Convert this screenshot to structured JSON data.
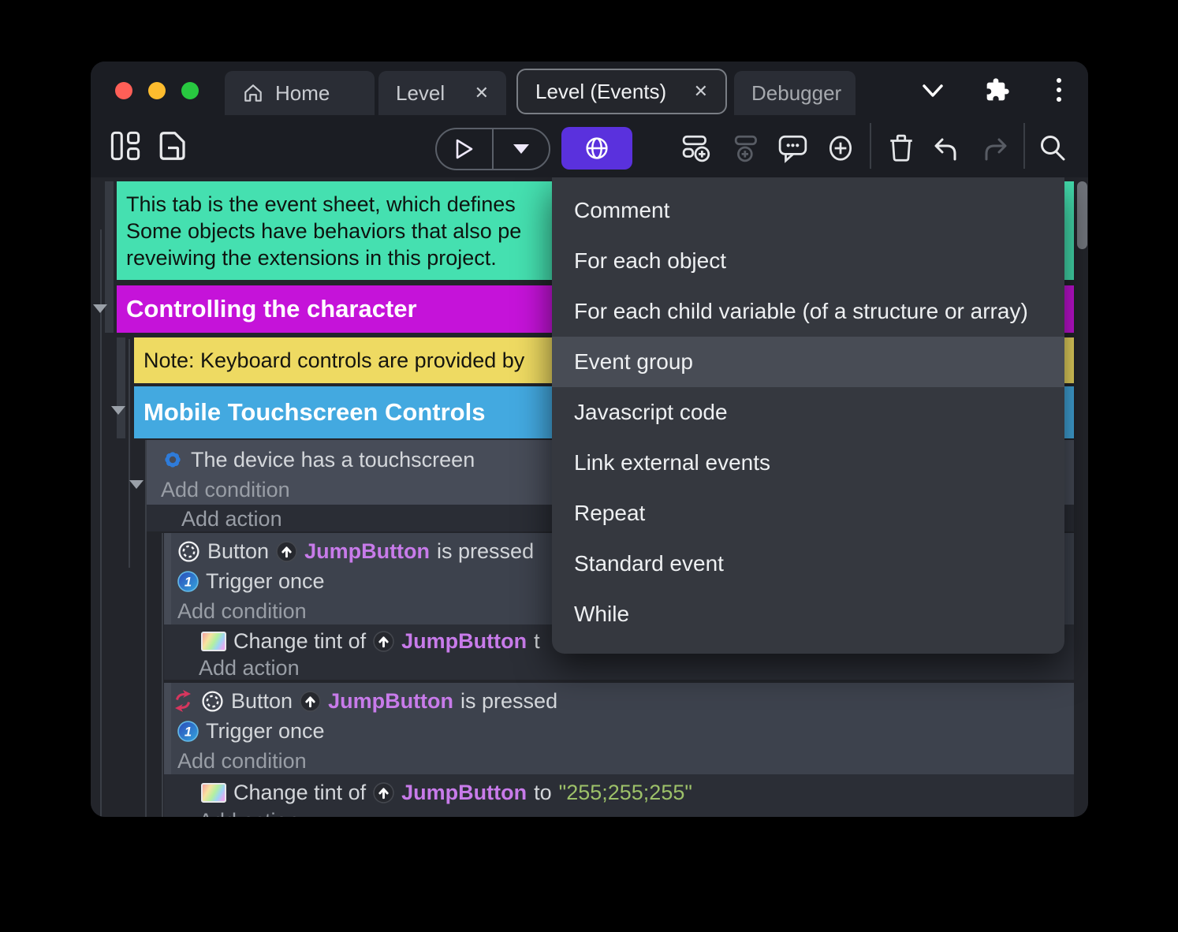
{
  "tabbar": {
    "tabs": [
      {
        "label": "Home"
      },
      {
        "label": "Level"
      },
      {
        "label": "Level (Events)"
      },
      {
        "label": "Debugger"
      }
    ],
    "close_glyph": "✕"
  },
  "event_sheet": {
    "comment_line1": "This tab is the event sheet, which defines",
    "comment_line2": "Some objects have behaviors that also pe",
    "comment_line3": "reveiwing the extensions in this project.",
    "group_controlling": "Controlling the character",
    "note": "Note: Keyboard controls are provided by",
    "group_mobile": "Mobile Touchscreen Controls",
    "device_condition": "The device has a touchscreen",
    "add_condition": "Add condition",
    "add_action": "Add action",
    "button_obj": "Button",
    "jump_button": "JumpButton",
    "is_pressed": "is pressed",
    "trigger_once": "Trigger once",
    "change_tint_prefix": "Change tint of",
    "to_clipped": "t",
    "to_word": "to",
    "tint_value": "\"255;255;255\""
  },
  "context_menu": {
    "items": [
      "Comment",
      "For each object",
      "For each child variable (of a structure or array)",
      "Event group",
      "Javascript code",
      "Link external events",
      "Repeat",
      "Standard event",
      "While"
    ],
    "highlighted": "Event group",
    "highlighted_index": 3
  },
  "colors": {
    "accent_purple": "#5a31dd",
    "comment_green": "#45e0b0",
    "group_magenta": "#c513d9",
    "note_yellow": "#eeda62",
    "group_blue": "#43a9e0",
    "object_purple": "#c87bea",
    "string_green": "#9dc169",
    "menu_highlight": "#484c55"
  }
}
